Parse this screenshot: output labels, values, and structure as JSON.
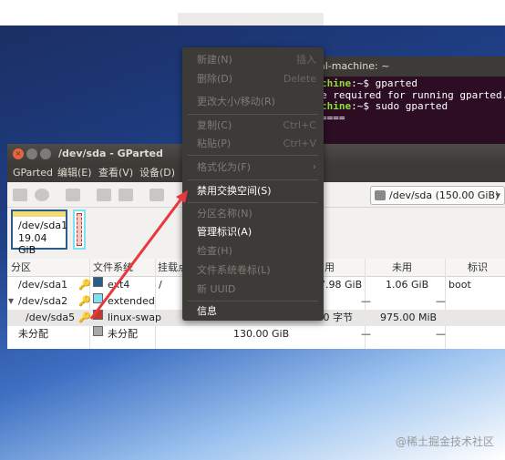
{
  "terminal": {
    "title": "al-machine: ~",
    "line1_host": "chine",
    "line1_rest": ":~$ gparted",
    "line2": "e required for running gparted.",
    "line3_host": "chine",
    "line3_rest": ":~$ sudo gparted",
    "line4": "===="
  },
  "window": {
    "title": "/dev/sda - GParted"
  },
  "menubar": {
    "items": [
      "GParted",
      "编辑(E)",
      "查看(V)",
      "设备(D)"
    ]
  },
  "toolbar": {
    "device_selector": "/dev/sda   (150.00 GiB)",
    "device_chevron": "▾"
  },
  "graph": {
    "sda1_name": "/dev/sda1",
    "sda1_size": "19.04 GiB"
  },
  "table": {
    "headers": [
      "分区",
      "文件系统",
      "挂载点",
      "用",
      "未用",
      "标识"
    ],
    "rows": [
      {
        "partition": "/dev/sda1",
        "fs": "ext4",
        "fs_color": "#2b5d8a",
        "mount": "/",
        "used": "7.98 GiB",
        "unused": "1.06 GiB",
        "flags": "boot"
      },
      {
        "partition": "/dev/sda2",
        "fs": "extended",
        "fs_color": "#7ee0f3",
        "mount": "",
        "used": "—",
        "unused": "—",
        "flags": ""
      },
      {
        "partition": "/dev/sda5",
        "fs": "linux-swap",
        "fs_color": "#c0392b",
        "mount": "",
        "used": ".00 字节",
        "unused": "975.00 MiB",
        "flags": ""
      },
      {
        "partition": "未分配",
        "fs": "未分配",
        "fs_color": "#a8a8a8",
        "mount": "",
        "size": "130.00 GiB",
        "used": "—",
        "unused": "—",
        "flags": ""
      }
    ]
  },
  "context_menu": {
    "items": [
      {
        "label": "新建(N)",
        "accel": "插入",
        "enabled": false
      },
      {
        "label": "删除(D)",
        "accel": "Delete",
        "enabled": false
      },
      {
        "label": "更改大小/移动(R)",
        "accel": "",
        "enabled": false
      },
      {
        "label": "复制(C)",
        "accel": "Ctrl+C",
        "enabled": false
      },
      {
        "label": "粘贴(P)",
        "accel": "Ctrl+V",
        "enabled": false
      },
      {
        "label": "格式化为(F)",
        "accel": "",
        "enabled": false
      },
      {
        "label": "禁用交换空间(S)",
        "accel": "",
        "enabled": true
      },
      {
        "label": "分区名称(N)",
        "accel": "",
        "enabled": false
      },
      {
        "label": "管理标识(A)",
        "accel": "",
        "enabled": true
      },
      {
        "label": "检查(H)",
        "accel": "",
        "enabled": false
      },
      {
        "label": "文件系统卷标(L)",
        "accel": "",
        "enabled": false
      },
      {
        "label": "新 UUID",
        "accel": "",
        "enabled": false
      },
      {
        "label": "信息",
        "accel": "",
        "enabled": true
      }
    ],
    "submenu_arrow": "›"
  },
  "watermark": "@稀土掘金技术社区",
  "colors": {
    "annotation_arrow": "#e8383d",
    "terminal_bg": "#2c0d24",
    "menu_bg": "#3c3b37"
  }
}
